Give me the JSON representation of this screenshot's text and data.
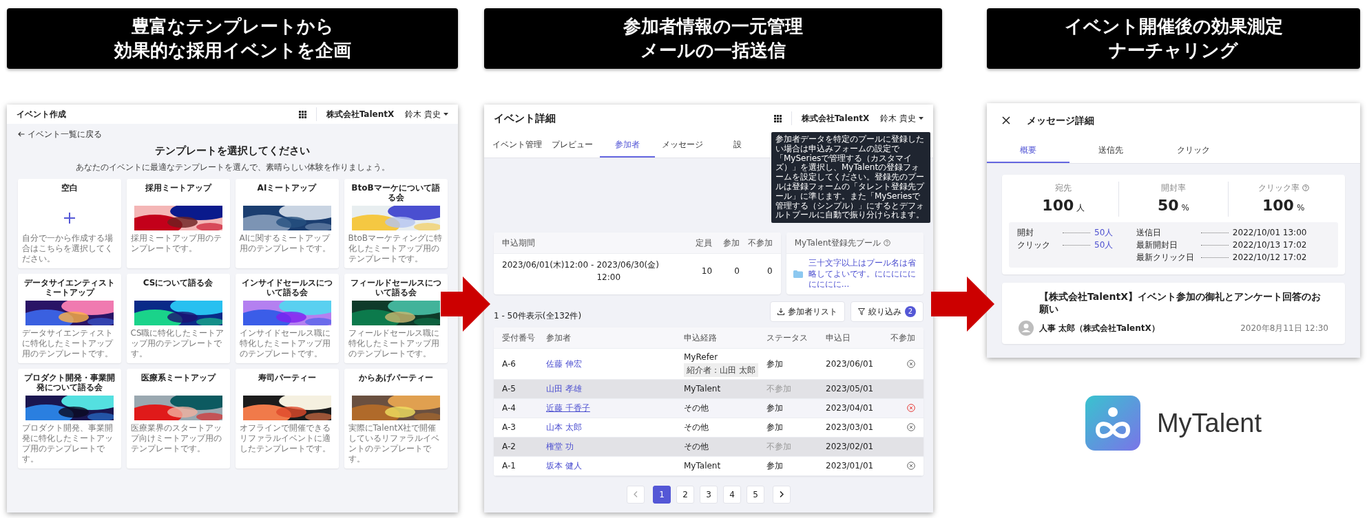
{
  "banners": [
    {
      "lines": [
        "豊富なテンプレートから",
        "効果的な採用イベントを企画"
      ]
    },
    {
      "lines": [
        "参加者情報の一元管理",
        "メールの一括送信"
      ]
    },
    {
      "lines": [
        "イベント開催後の効果測定",
        "ナーチャリング"
      ]
    }
  ],
  "template_screen": {
    "title": "イベント作成",
    "company": "株式会社TalentX",
    "user": "鈴木 貴史",
    "back_link": "イベント一覧に戻る",
    "heading": "テンプレートを選択してください",
    "subheading": "あなたのイベントに最適なテンプレートを選んで、素晴らしい体験を作りましょう。",
    "templates": [
      {
        "kind": "blank",
        "title": "空白",
        "description": "自分で一から作成する場合はこちらを選択してください。"
      },
      {
        "kind": "picture",
        "title": "採用ミートアップ",
        "description": "採用ミートアップ用のテンプレートです。"
      },
      {
        "kind": "picture",
        "title": "AIミートアップ",
        "description": "AIに関するミートアップ用のテンプレートです。"
      },
      {
        "kind": "picture",
        "title": "BtoBマーケについて語る会",
        "description": "BtoBマーケティングに特化したミートアップ用のテンプレートです。"
      },
      {
        "kind": "picture",
        "title": "データサイエンティストミートアップ",
        "description": "データサイエンティストに特化したミートアップ用のテンプレートです。"
      },
      {
        "kind": "picture",
        "title": "CSについて語る会",
        "description": "CS職に特化したミートアップ用のテンプレートです。"
      },
      {
        "kind": "picture",
        "title": "インサイドセールスについて語る会",
        "description": "インサイドセールス職に特化したミートアップ用のテンプレートです。"
      },
      {
        "kind": "picture",
        "title": "フィールドセールスについて語る会",
        "description": "フィールドセールス職に特化したミートアップ用のテンプレートです。"
      },
      {
        "kind": "picture",
        "title": "プロダクト開発・事業開発について語る会",
        "description": "プロダクト開発、事業開発に特化したミートアップ用のテンプレートです。"
      },
      {
        "kind": "picture",
        "title": "医療系ミートアップ",
        "description": "医療業界のスタートアップ向けミートアップ用のテンプレートです。"
      },
      {
        "kind": "picture",
        "title": "寿司パーティー",
        "description": "オフラインで開催できるリファラルイベントに適したテンプレートです。"
      },
      {
        "kind": "picture",
        "title": "からあげパーティー",
        "description": "実際にTalentX社で開催しているリファラルイベントのテンプレートです。"
      }
    ]
  },
  "participants_screen": {
    "title": "イベント詳細",
    "company": "株式会社TalentX",
    "user": "鈴木 貴史",
    "tabs": [
      {
        "label": "イベント管理",
        "selected": false
      },
      {
        "label": "プレビュー",
        "selected": false
      },
      {
        "label": "参加者",
        "selected": true
      },
      {
        "label": "メッセージ",
        "selected": false
      },
      {
        "label": "設",
        "selected": false
      }
    ],
    "tooltip": "参加者データを特定のプールに登録したい場合は申込みフォームの設定で「MySeriesで管理する（カスタマイズ）」を選択し、MyTalentの登録フォームを設定してください。登録先のプールは登録フォームの「タレント登録先プール」に準じます。また「MySeriesで管理する（シンプル）」にするとデフォルトプールに自動で振り分けられます。",
    "summary": {
      "columns": [
        "申込期間",
        "定員",
        "参加",
        "不参加"
      ],
      "period_start": "2023/06/01(木)12:00",
      "period_separator": "-",
      "period_end": "2023/06/30(金) 12:00",
      "values": [
        "10",
        "0",
        "0"
      ]
    },
    "pool": {
      "label": "MyTalent登録先プール",
      "name": "三十文字以上はプール名は省略してよいです。ににににににににに..."
    },
    "count": "1 - 50件表示(全132件)",
    "buttons": [
      {
        "kind": "download",
        "label": "参加者リスト"
      },
      {
        "kind": "filter",
        "label": "絞り込み",
        "badge": "2"
      }
    ],
    "table": {
      "columns": [
        "受付番号",
        "参加者",
        "申込経路",
        "ステータス",
        "申込日",
        "不参加"
      ],
      "rows": [
        {
          "number": "A-6",
          "name": "佐藤 伸宏",
          "route": "MyRefer",
          "referrer": "紹介者：山田 太郎",
          "status": "参加",
          "date": "2023/06/01",
          "attending": true,
          "hovered": false
        },
        {
          "number": "A-5",
          "name": "山田 孝雄",
          "route": "MyTalent",
          "status": "不参加",
          "date": "2023/05/01",
          "attending": false,
          "hovered": false
        },
        {
          "number": "A-4",
          "name": "近藤 千香子",
          "route": "その他",
          "status": "参加",
          "date": "2023/04/01",
          "attending": true,
          "hovered": true
        },
        {
          "number": "A-3",
          "name": "山本 太郎",
          "route": "その他",
          "status": "参加",
          "date": "2023/03/01",
          "attending": true,
          "hovered": false
        },
        {
          "number": "A-2",
          "name": "権堂 功",
          "route": "その他",
          "status": "不参加",
          "date": "2023/02/01",
          "attending": false,
          "hovered": false
        },
        {
          "number": "A-1",
          "name": "坂本 健人",
          "route": "MyTalent",
          "status": "参加",
          "date": "2023/01/01",
          "attending": true,
          "hovered": false
        }
      ]
    },
    "pagination": {
      "prev_disabled": true,
      "pages": [
        {
          "label": "1",
          "selected": true
        },
        {
          "label": "2",
          "selected": false
        },
        {
          "label": "3",
          "selected": false
        },
        {
          "label": "4",
          "selected": false
        },
        {
          "label": "5",
          "selected": false
        }
      ]
    }
  },
  "message_screen": {
    "title": "メッセージ詳細",
    "tabs": [
      {
        "label": "概要",
        "selected": true
      },
      {
        "label": "送信先",
        "selected": false
      },
      {
        "label": "クリック",
        "selected": false
      }
    ],
    "stats": [
      {
        "label": "宛先",
        "value": "100",
        "unit": "人",
        "help": false
      },
      {
        "label": "開封率",
        "value": "50",
        "unit": "%",
        "help": false
      },
      {
        "label": "クリック率",
        "value": "100",
        "unit": "%",
        "help": true
      }
    ],
    "details_left": [
      {
        "label": "開封",
        "value": "50人",
        "link": true
      },
      {
        "label": "クリック",
        "value": "50人",
        "link": true
      }
    ],
    "details_right": [
      {
        "label": "送信日",
        "value": "2022/10/01 13:00",
        "link": false
      },
      {
        "label": "最新開封日",
        "value": "2022/10/13 17:02",
        "link": false
      },
      {
        "label": "最新クリック日",
        "value": "2022/10/12 17:02",
        "link": false
      }
    ],
    "message": {
      "subject": "【株式会社TalentX】イベント参加の御礼とアンケート回答のお願い",
      "sender": "人事 太郎（株式会社TalentX）",
      "date": "2020年8月11日 12:30"
    }
  },
  "logo": {
    "text": "MyTalent"
  }
}
